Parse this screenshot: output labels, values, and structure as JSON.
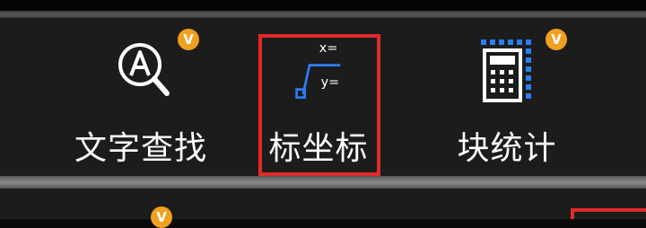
{
  "colors": {
    "toolbar_bg": "#1c1c1c",
    "label": "#ffffff",
    "vip_badge": "#f0a020",
    "highlight": "#e02b2b",
    "accent_blue": "#2a7ef5"
  },
  "toolbar": {
    "tools": [
      {
        "label": "文字查找",
        "icon": "text-search-icon",
        "badge": "V"
      },
      {
        "label": "标坐标",
        "icon": "coordinate-icon",
        "icon_text": {
          "x": "x=",
          "y": "y="
        }
      },
      {
        "label": "块统计",
        "icon": "block-count-icon",
        "badge": "V"
      }
    ]
  },
  "bottom_bar": {
    "badge": "V"
  }
}
